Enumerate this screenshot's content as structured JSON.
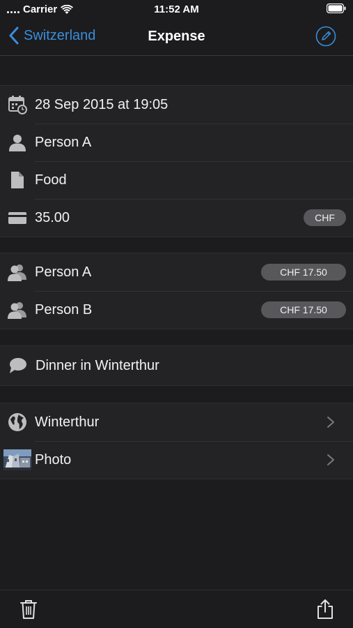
{
  "status": {
    "carrier": "Carrier",
    "time": "11:52 AM"
  },
  "nav": {
    "back_label": "Switzerland",
    "title": "Expense",
    "accent_color": "#3a8edb"
  },
  "details": [
    {
      "icon": "calendar-icon",
      "label": "28 Sep 2015 at 19:05"
    },
    {
      "icon": "person-icon",
      "label": "Person A"
    },
    {
      "icon": "document-icon",
      "label": "Food"
    },
    {
      "icon": "credit-card-icon",
      "label": "35.00",
      "badge": "CHF"
    }
  ],
  "split": [
    {
      "icon": "people-icon",
      "label": "Person A",
      "badge": "CHF 17.50"
    },
    {
      "icon": "people-icon",
      "label": "Person B",
      "badge": "CHF 17.50"
    }
  ],
  "note": {
    "icon": "speech-bubble-icon",
    "label": "Dinner in Winterthur"
  },
  "links": [
    {
      "icon": "globe-icon",
      "label": "Winterthur"
    },
    {
      "icon": "photo-thumbnail",
      "label": "Photo"
    }
  ],
  "toolbar": {
    "left_icon": "trash-icon",
    "right_icon": "share-icon"
  }
}
